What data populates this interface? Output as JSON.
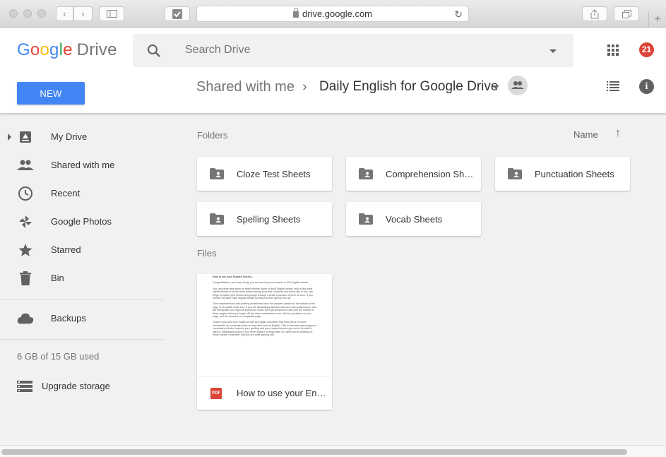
{
  "browser": {
    "url": "drive.google.com"
  },
  "header": {
    "logo_google": [
      "G",
      "o",
      "o",
      "g",
      "l",
      "e"
    ],
    "logo_product": "Drive",
    "search_placeholder": "Search Drive",
    "notification_count": "21",
    "new_button": "NEW"
  },
  "breadcrumb": {
    "parent": "Shared with me",
    "separator": "›",
    "current": "Daily English for Google Drive"
  },
  "sidebar": {
    "items": [
      {
        "label": "My Drive",
        "icon": "my-drive-icon"
      },
      {
        "label": "Shared with me",
        "icon": "people-icon"
      },
      {
        "label": "Recent",
        "icon": "clock-icon"
      },
      {
        "label": "Google Photos",
        "icon": "pinwheel-icon"
      },
      {
        "label": "Starred",
        "icon": "star-icon"
      },
      {
        "label": "Bin",
        "icon": "trash-icon"
      },
      {
        "label": "Backups",
        "icon": "cloud-icon"
      }
    ],
    "storage_text": "6 GB of 15 GB used",
    "upgrade_label": "Upgrade storage"
  },
  "main": {
    "folders_label": "Folders",
    "files_label": "Files",
    "sort_label": "Name",
    "folders": [
      "Cloze Test Sheets",
      "Comprehension Sheets",
      "Punctuation Sheets",
      "Spelling Sheets",
      "Vocab Sheets"
    ],
    "files": [
      {
        "name": "How to use your English Sheets",
        "type": "PDF",
        "preview": {
          "title": "How to use your English Sheets...",
          "paragraphs": [
            "Congratulations, you lucky thing, you are now the proud owner of 100 English sheets.",
            "You can either treat them as three months' worth of daily English sheets (with a few extra sheets thrown in for the keen-beans among you) and complete one every day, or you can binge complete your sheets and plough through a whole mountain of them at once. If you choose the latter, take regular breaks so that you don't get too fed-up!",
            "The comprehension and spelling worksheets have the answers printed on the bottom of the page in an upside-down box. If you are fantastically talented and can read upside-down, and are feeling like you might be inclined to cheat, then get someone to fold over the bottom of these pages before you begin. All the other worksheets come with the questions on one page, and the answers on a separate page.",
            "Those of you who love maths as well as English will notice that there are a lot more worksheets on vocabulary than on any other area of English. This is because improving your vocabulary will also improve your spelling and your comprehension (you won't be able to spell or understand a word if you never knew it to begin with! So, when you're working on these sheets, remember that you are multi-tasking and"
          ]
        }
      }
    ]
  }
}
